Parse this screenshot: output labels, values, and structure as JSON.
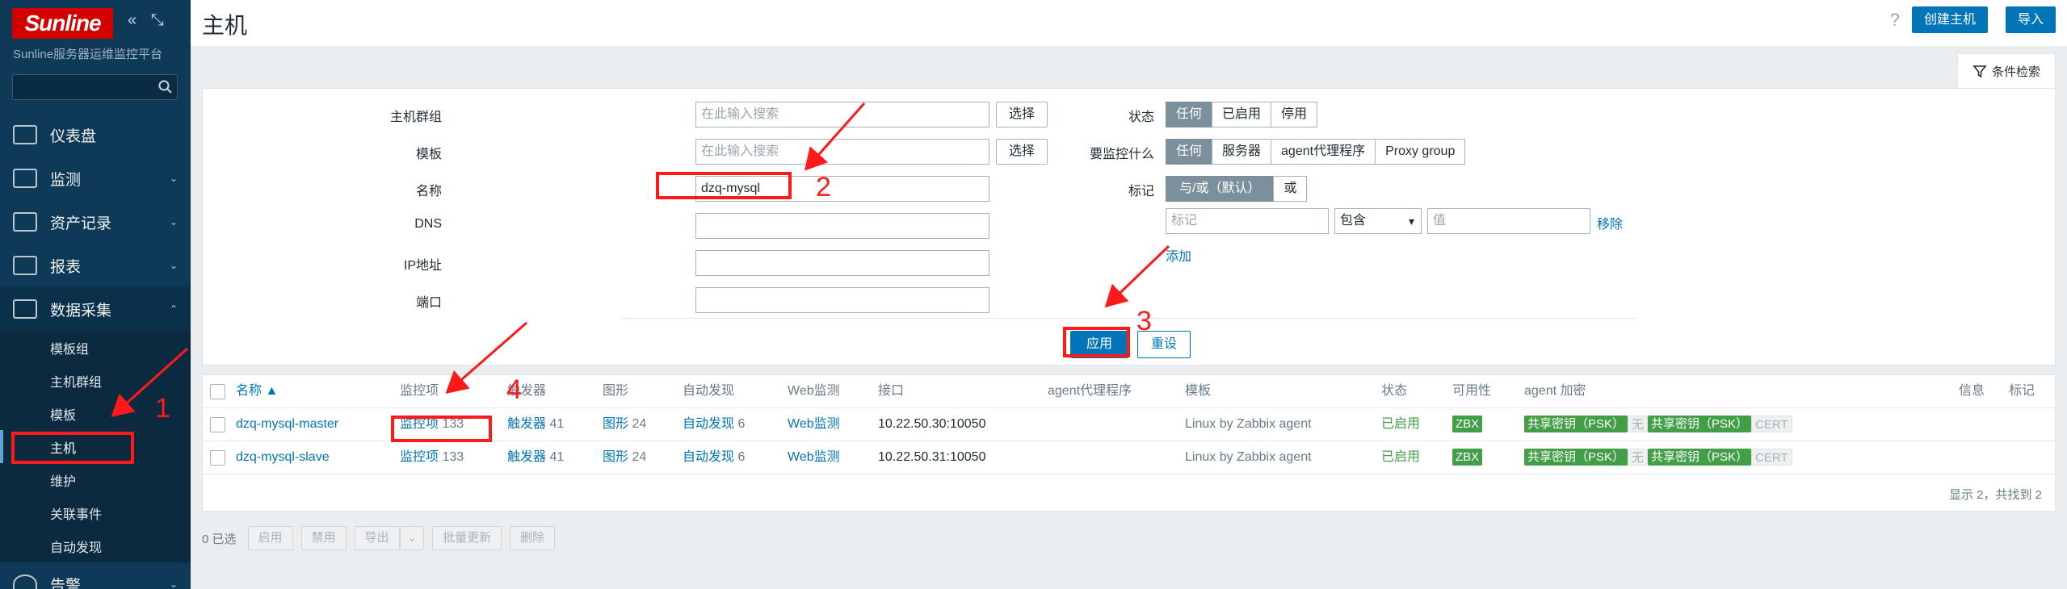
{
  "brand": {
    "logo": "Sunline",
    "subtitle": "Sunline服务器运维监控平台"
  },
  "sidebar": {
    "items": [
      {
        "label": "仪表盘",
        "icon": "dashboard-icon"
      },
      {
        "label": "监测",
        "icon": "monitoring-icon"
      },
      {
        "label": "资产记录",
        "icon": "inventory-icon"
      },
      {
        "label": "报表",
        "icon": "reports-icon"
      },
      {
        "label": "数据采集",
        "icon": "data-collection-icon"
      }
    ],
    "sub_items": [
      "模板组",
      "主机群组",
      "模板",
      "主机",
      "维护",
      "关联事件",
      "自动发现"
    ],
    "next_item": "告警"
  },
  "header": {
    "title": "主机",
    "help": "?",
    "create_label": "创建主机",
    "import_label": "导入"
  },
  "filter": {
    "tab_label": "条件检索",
    "host_group_label": "主机群组",
    "host_group_placeholder": "在此输入搜索",
    "template_label": "模板",
    "template_placeholder": "在此输入搜索",
    "select_label": "选择",
    "name_label": "名称",
    "name_value": "dzq-mysql",
    "dns_label": "DNS",
    "ip_label": "IP地址",
    "port_label": "端口",
    "status_label": "状态",
    "status_options": [
      "任何",
      "已启用",
      "停用"
    ],
    "monitored_by_label": "要监控什么",
    "monitored_by_options": [
      "任何",
      "服务器",
      "agent代理程序",
      "Proxy group"
    ],
    "tags_label": "标记",
    "tags_mode_options": [
      "与/或（默认）",
      "或"
    ],
    "tag_placeholder": "标记",
    "tag_operator": "包含",
    "tag_value_placeholder": "值",
    "remove_label": "移除",
    "add_label": "添加",
    "apply_label": "应用",
    "reset_label": "重设"
  },
  "table": {
    "headers": {
      "name": "名称 ▲",
      "items": "监控项",
      "triggers": "触发器",
      "graphs": "图形",
      "discovery": "自动发现",
      "web": "Web监测",
      "interface": "接口",
      "proxy": "agent代理程序",
      "templates": "模板",
      "status": "状态",
      "availability": "可用性",
      "encryption": "agent 加密",
      "info": "信息",
      "tags": "标记"
    },
    "rows": [
      {
        "name": "dzq-mysql-master",
        "items": "监控项",
        "items_count": "133",
        "triggers": "触发器",
        "triggers_count": "41",
        "graphs": "图形",
        "graphs_count": "24",
        "discovery": "自动发现",
        "discovery_count": "6",
        "web": "Web监测",
        "interface": "10.22.50.30:10050",
        "template": "Linux by Zabbix agent",
        "status": "已启用",
        "availability": "ZBX",
        "enc1": "共享密钥（PSK）",
        "enc_none": "无",
        "enc2": "共享密钥（PSK）",
        "enc_cert": "CERT"
      },
      {
        "name": "dzq-mysql-slave",
        "items": "监控项",
        "items_count": "133",
        "triggers": "触发器",
        "triggers_count": "41",
        "graphs": "图形",
        "graphs_count": "24",
        "discovery": "自动发现",
        "discovery_count": "6",
        "web": "Web监测",
        "interface": "10.22.50.31:10050",
        "template": "Linux by Zabbix agent",
        "status": "已启用",
        "availability": "ZBX",
        "enc1": "共享密钥（PSK）",
        "enc_none": "无",
        "enc2": "共享密钥（PSK）",
        "enc_cert": "CERT"
      }
    ],
    "footer": "显示 2，共找到 2"
  },
  "bottom_bar": {
    "selected": "0 已选",
    "actions": [
      "启用",
      "禁用",
      "导出",
      "批量更新",
      "删除"
    ]
  },
  "annotations": [
    "1",
    "2",
    "3",
    "4"
  ],
  "colors": {
    "sidebar": "#0e3a57",
    "accent": "#0275b8",
    "annotation": "#ff1a1a",
    "success": "#429e47"
  }
}
